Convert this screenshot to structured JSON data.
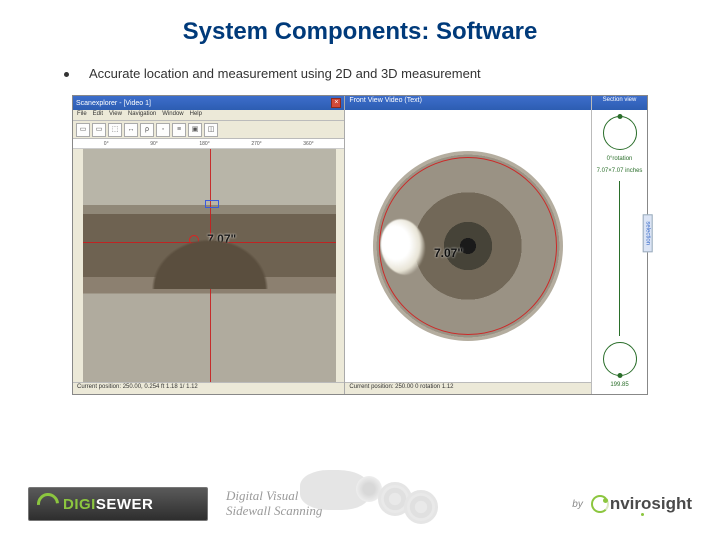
{
  "title": "System Components: Software",
  "bullet": "Accurate location and measurement using 2D and 3D measurement",
  "left_window": {
    "title": "Scanexplorer - [Video 1]",
    "menus": [
      "File",
      "Edit",
      "View",
      "Navigation",
      "Window",
      "Help"
    ],
    "ruler_marks": [
      "0°",
      "90°",
      "180°",
      "270°",
      "360°"
    ],
    "measurement": "7.07\"",
    "status": "Current position: 250.00, 0.254 ft    1.18    1/ 1.12"
  },
  "right_window": {
    "title": "Front View Video (Text)",
    "measurement": "7.07\"",
    "status": "Current position: 250.00  0 rotation    1.12"
  },
  "side_panel": {
    "title": "Section view",
    "top_label": "0°rotation",
    "bottom_label": "199.85",
    "dims": "7.07×7.07 inches",
    "handle": "selection"
  },
  "footer": {
    "brand_a": "DIGI",
    "brand_b": "SEWER",
    "tagline_line1": "Digital Visual",
    "tagline_line2": "Sidewall Scanning",
    "by": "by",
    "env_tail": "nvirosight"
  }
}
